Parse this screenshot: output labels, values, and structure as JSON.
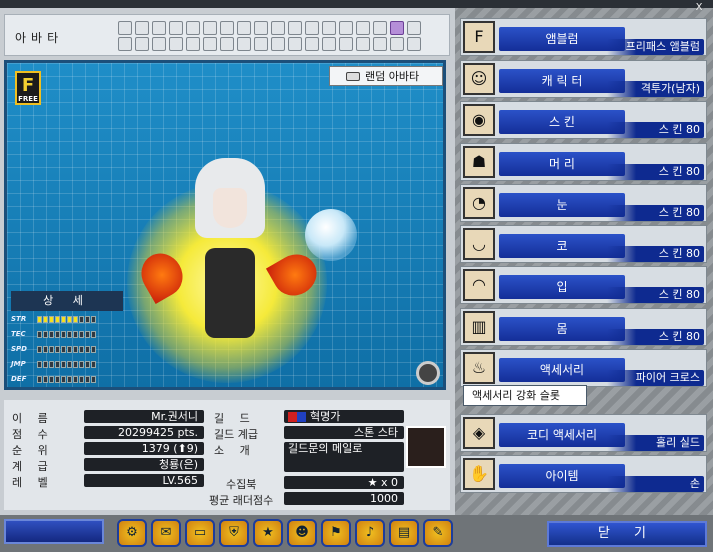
{
  "window": {
    "close": "X"
  },
  "avatar_tab": {
    "label": "아바타"
  },
  "stage": {
    "free_badge": "F",
    "free_sub": "FREE",
    "random_avatar": "랜덤 아바타"
  },
  "detail": {
    "title": "상 세"
  },
  "stats": [
    {
      "name": "STR",
      "level": 7
    },
    {
      "name": "TEC",
      "level": 0
    },
    {
      "name": "SPD",
      "level": 0
    },
    {
      "name": "JMP",
      "level": 0
    },
    {
      "name": "DEF",
      "level": 0
    }
  ],
  "info": {
    "name_label": "이 름",
    "name_value": "Mr.권서니",
    "score_label": "점 수",
    "score_value": "20299425 pts.",
    "rank_label": "순 위",
    "rank_value": "1379 (⬆9)",
    "grade_label": "계 급",
    "grade_value": "청룡(은)",
    "level_label": "레 벨",
    "level_value": "LV.565",
    "guild_label": "길 드",
    "guild_value": "혁명가",
    "guild_rank_label": "길드 계급",
    "guild_rank_value": "스톤 스타",
    "intro_label": "소 개",
    "intro_value": "길드문의 메일로",
    "collection_label": "수집북",
    "collection_value": "x 0",
    "ladder_label": "평균 래더점수",
    "ladder_value": "1000"
  },
  "menu": [
    {
      "category": "앰블럼",
      "value": "프리패스 앰블럼",
      "icon": "emblem-icon"
    },
    {
      "category": "캐 릭 터",
      "value": "격투가(남자)",
      "icon": "character-icon"
    },
    {
      "category": "스 킨",
      "value": "스 킨 80",
      "icon": "skin-icon"
    },
    {
      "category": "머 리",
      "value": "스 킨 80",
      "icon": "hair-icon"
    },
    {
      "category": "눈",
      "value": "스 킨 80",
      "icon": "eye-icon"
    },
    {
      "category": "코",
      "value": "스 킨 80",
      "icon": "nose-icon"
    },
    {
      "category": "입",
      "value": "스 킨 80",
      "icon": "mouth-icon"
    },
    {
      "category": "몸",
      "value": "스 킨 80",
      "icon": "body-icon"
    },
    {
      "category": "액세서리",
      "value": "파이어 크로스",
      "icon": "accessory-icon"
    },
    {
      "category": "코디 액세서리",
      "value": "홀리 실드",
      "icon": "codi-accessory-icon"
    },
    {
      "category": "아이템",
      "value": "손",
      "icon": "item-icon"
    }
  ],
  "accessory_slot": "액세서리 강화 슬롯",
  "bottom": {
    "close_label": "닫 기",
    "icons": [
      "gear-icon",
      "chat-icon",
      "card-icon",
      "shield-icon",
      "star-icon",
      "people-icon",
      "bag-icon",
      "bell-icon",
      "chart-icon",
      "note-icon"
    ]
  }
}
